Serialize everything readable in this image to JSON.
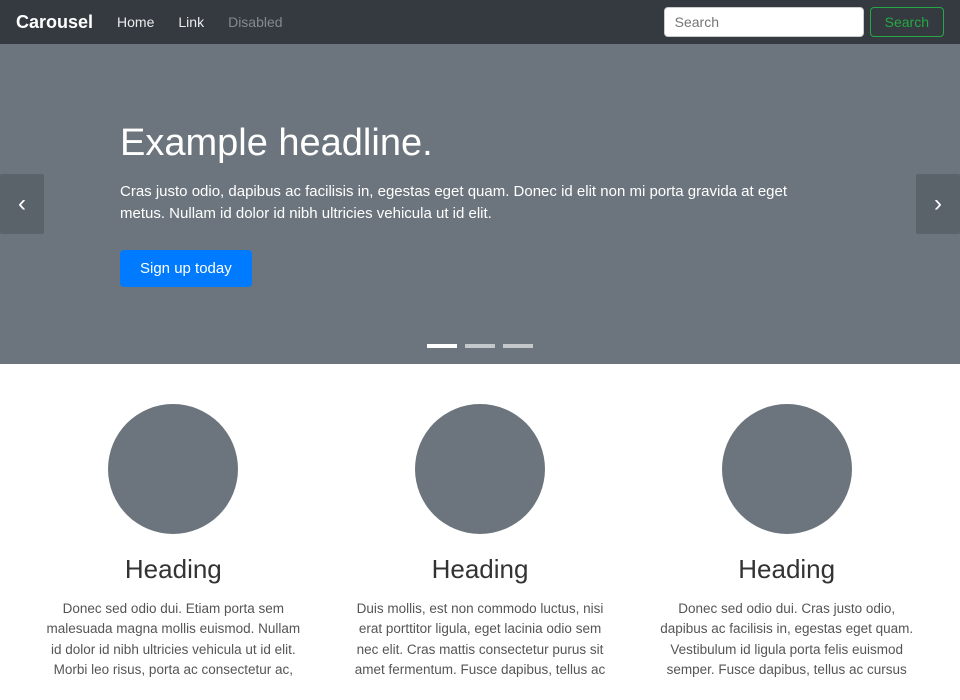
{
  "navbar": {
    "brand": "Carousel",
    "links": [
      {
        "label": "Home",
        "disabled": false
      },
      {
        "label": "Link",
        "disabled": false
      },
      {
        "label": "Disabled",
        "disabled": true
      }
    ],
    "search_placeholder": "Search",
    "search_button_label": "Search"
  },
  "carousel": {
    "headline": "Example headline.",
    "body": "Cras justo odio, dapibus ac facilisis in, egestas eget quam. Donec id elit non mi porta gravida at eget metus. Nullam id dolor id nibh ultricies vehicula ut id elit.",
    "cta_label": "Sign up today",
    "prev_label": "‹",
    "next_label": "›",
    "dots": [
      {
        "active": true
      },
      {
        "active": false
      },
      {
        "active": false
      }
    ]
  },
  "columns": [
    {
      "heading": "Heading",
      "text": "Donec sed odio dui. Etiam porta sem malesuada magna mollis euismod. Nullam id dolor id nibh ultricies vehicula ut id elit. Morbi leo risus, porta ac consectetur ac,"
    },
    {
      "heading": "Heading",
      "text": "Duis mollis, est non commodo luctus, nisi erat porttitor ligula, eget lacinia odio sem nec elit. Cras mattis consectetur purus sit amet fermentum. Fusce dapibus, tellus ac"
    },
    {
      "heading": "Heading",
      "text": "Donec sed odio dui. Cras justo odio, dapibus ac facilisis in, egestas eget quam. Vestibulum id ligula porta felis euismod semper. Fusce dapibus, tellus ac cursus"
    }
  ]
}
